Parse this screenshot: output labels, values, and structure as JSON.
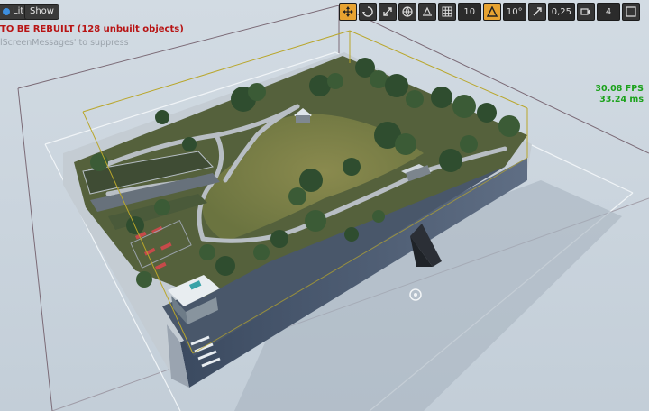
{
  "viewport": {
    "lit_label": "Lit",
    "show_label": "Show"
  },
  "messages": {
    "rebuild_warning": "TO BE REBUILT (128 unbuilt objects)",
    "suppress_hint": "lScreenMessages' to suppress"
  },
  "toolbar": {
    "grid_snap_value": "10",
    "rotation_snap_value": "10°",
    "scale_snap_value": "0,25",
    "camera_speed_value": "4"
  },
  "stats": {
    "fps": "30.08 FPS",
    "ms": "33.24 ms"
  }
}
